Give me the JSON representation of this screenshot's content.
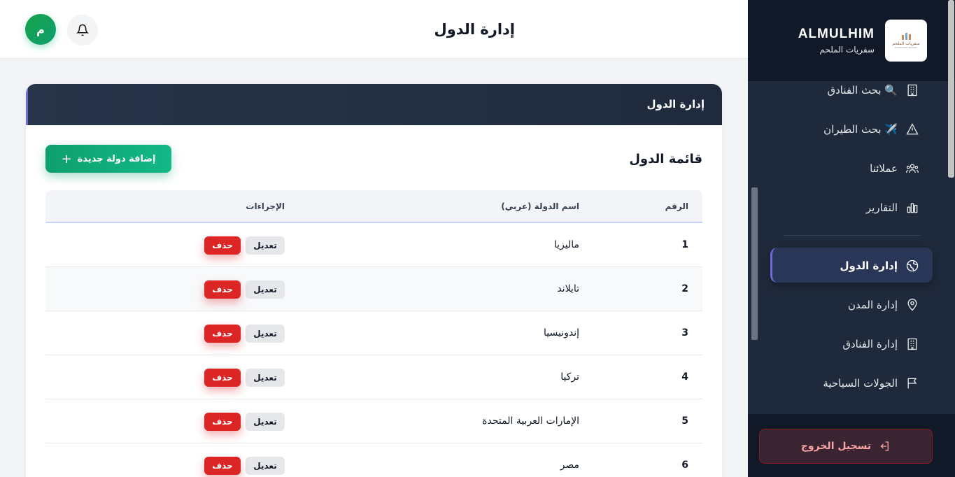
{
  "brand": {
    "title": "ALMULHIM",
    "subtitle": "سفريات الملحم",
    "logo_text": "سفريات الملحم",
    "logo_subtext": "ALMULHIM TRAVEL"
  },
  "sidebar": {
    "items": [
      {
        "label": "🔍 بحث الفنادق",
        "icon": "building-icon"
      },
      {
        "label": "✈️ بحث الطيران",
        "icon": "plane-icon"
      },
      {
        "label": "عملائنا",
        "icon": "users-icon"
      },
      {
        "label": "التقارير",
        "icon": "chart-icon"
      },
      {
        "label": "إدارة الدول",
        "icon": "globe-icon",
        "active": true
      },
      {
        "label": "إدارة المدن",
        "icon": "map-pin-icon"
      },
      {
        "label": "إدارة الفنادق",
        "icon": "building-icon"
      },
      {
        "label": "الجولات السياحية",
        "icon": "flag-icon"
      }
    ],
    "logout_label": "تسجيل الخروج"
  },
  "topbar": {
    "title": "إدارة الدول",
    "avatar_initial": "م"
  },
  "card": {
    "header_title": "إدارة الدول",
    "list_title": "قائمة الدول",
    "add_button_label": "إضافة دولة جديدة",
    "columns": [
      "الرقم",
      "اسم الدولة (عربي)",
      "الإجراءات"
    ],
    "rows": [
      {
        "num": "1",
        "name": "ماليزيا"
      },
      {
        "num": "2",
        "name": "تايلاند"
      },
      {
        "num": "3",
        "name": "إندونيسيا"
      },
      {
        "num": "4",
        "name": "تركيا"
      },
      {
        "num": "5",
        "name": "الإمارات العربية المتحدة"
      },
      {
        "num": "6",
        "name": "مصر"
      }
    ],
    "edit_label": "تعديل",
    "delete_label": "حذف"
  },
  "colors": {
    "accent": "#6d6bd6",
    "primary_green": "#10a37a",
    "danger": "#dc2626",
    "sidebar_bg": "#1e293b"
  }
}
